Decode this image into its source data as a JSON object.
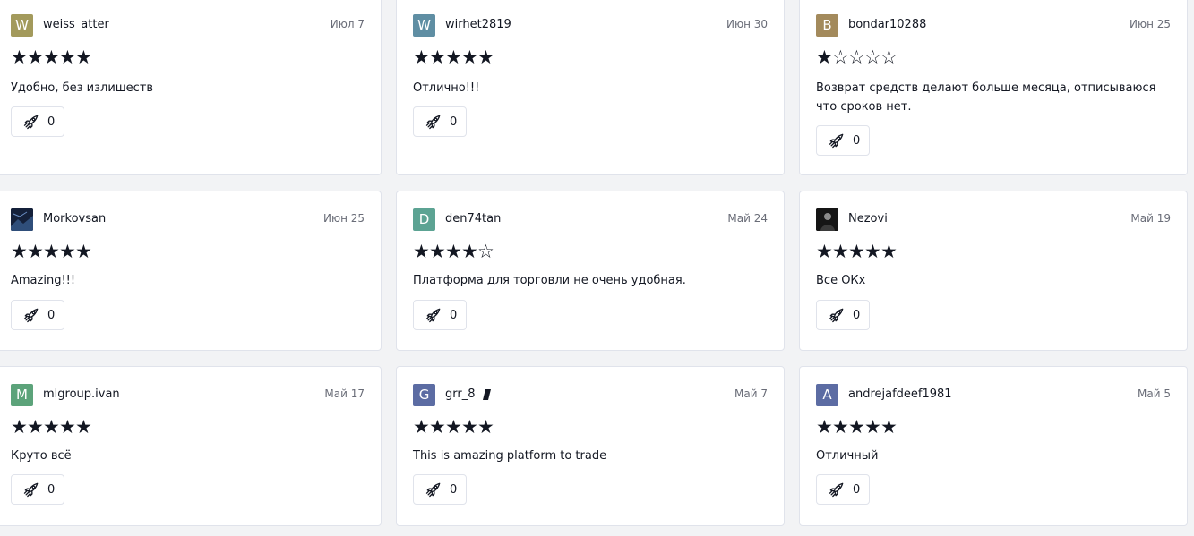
{
  "colors": {
    "W1": "#a39a5c",
    "W2": "#5f8ea3",
    "B": "#a38a5c",
    "D": "#5ca393",
    "M": "#5ca37a",
    "G": "#5c6ca3",
    "A": "#5c6ca3"
  },
  "reviews": [
    {
      "initial": "W",
      "username": "weiss_atter",
      "date": "Июл 7",
      "rating": 5,
      "text": "Удобно, без излишеств",
      "boosts": "0"
    },
    {
      "initial": "W",
      "username": "wirhet2819",
      "date": "Июн 30",
      "rating": 5,
      "text": "Отлично!!!",
      "boosts": "0"
    },
    {
      "initial": "B",
      "username": "bondar10288",
      "date": "Июн 25",
      "rating": 1,
      "text": "Возврат средств делают больше месяца, отписываюся что сроков нет.",
      "boosts": "0"
    },
    {
      "initial": "",
      "username": "Morkovsan",
      "date": "Июн 25",
      "rating": 5,
      "text": "Amazing!!!",
      "boosts": "0"
    },
    {
      "initial": "D",
      "username": "den74tan",
      "date": "Май 24",
      "rating": 4,
      "text": "Платформа для торговли не очень удобная.",
      "boosts": "0"
    },
    {
      "initial": "",
      "username": "Nezovi",
      "date": "Май 19",
      "rating": 5,
      "text": "Все ОКх",
      "boosts": "0"
    },
    {
      "initial": "M",
      "username": "mlgroup.ivan",
      "date": "Май 17",
      "rating": 5,
      "text": "Круто всё",
      "boosts": "0"
    },
    {
      "initial": "G",
      "username": "grr_8",
      "date": "Май 7",
      "rating": 5,
      "text": "This is amazing platform to trade",
      "boosts": "0"
    },
    {
      "initial": "A",
      "username": "andrejafdeef1981",
      "date": "Май 5",
      "rating": 5,
      "text": "Отличный",
      "boosts": "0"
    }
  ],
  "icons": {
    "boost": "rocket-icon",
    "star_filled": "★",
    "star_empty": "☆"
  }
}
